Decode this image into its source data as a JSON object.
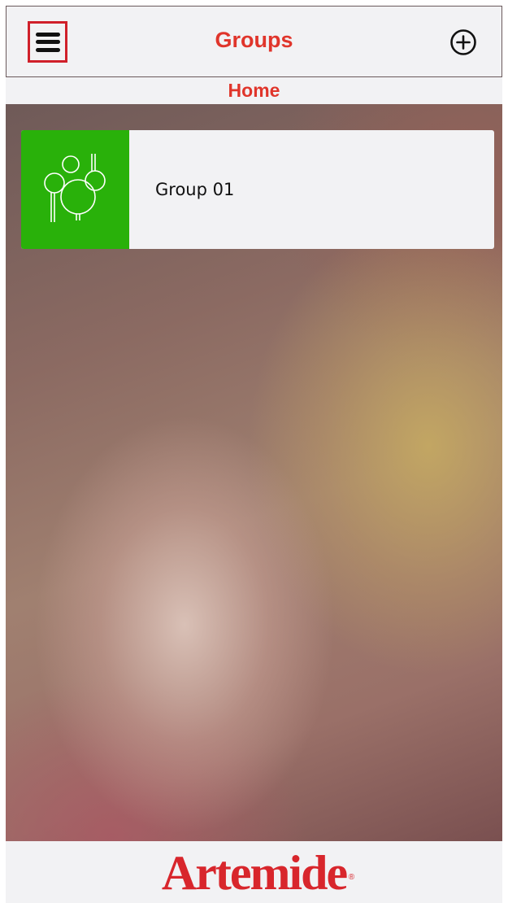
{
  "header": {
    "title": "Groups",
    "menu_icon": "hamburger-menu-icon",
    "add_icon": "plus-circle-icon"
  },
  "subheader": {
    "label": "Home"
  },
  "groups": [
    {
      "label": "Group 01",
      "icon": "trees-icon",
      "color": "#29b10a"
    }
  ],
  "footer": {
    "logo_text": "Artemide",
    "registered_mark": "®"
  },
  "colors": {
    "accent": "#e0352b",
    "group_tile": "#29b10a",
    "brand": "#d8262c"
  }
}
